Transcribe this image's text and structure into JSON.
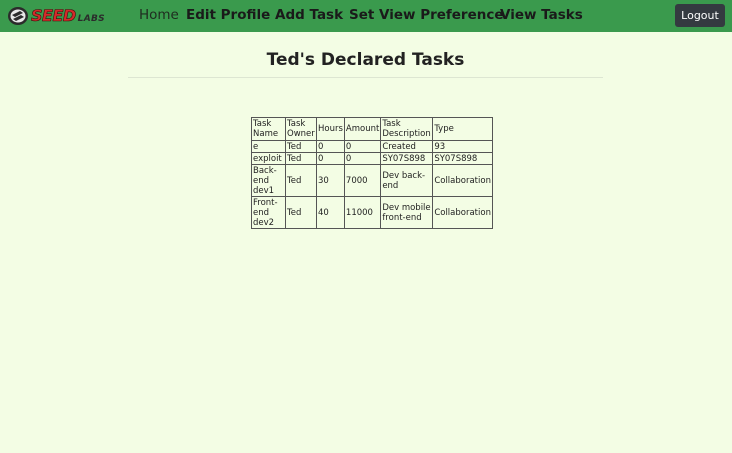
{
  "navbar": {
    "logo": {
      "text_seed": "SEED",
      "text_labs": "LABS"
    },
    "links": {
      "home": "Home",
      "edit_profile": "Edit Profile",
      "add_task": "Add Task",
      "set_view_preference": "Set View Preference",
      "view_tasks": "View Tasks"
    },
    "logout_label": "Logout",
    "colors": {
      "bar": "#3a9a4d",
      "logout_bg": "#343a40"
    }
  },
  "page": {
    "title": "Ted's Declared Tasks",
    "background": "#f3fde4"
  },
  "table": {
    "headers": [
      "Task Name",
      "Task Owner",
      "Hours",
      "Amount",
      "Task Description",
      "Type"
    ],
    "rows": [
      [
        "e",
        "Ted",
        "0",
        "0",
        "Created",
        "93"
      ],
      [
        "exploit",
        "Ted",
        "0",
        "0",
        "SY07S898",
        "SY07S898"
      ],
      [
        "Back-end dev1",
        "Ted",
        "30",
        "7000",
        "Dev back-end",
        "Collaboration"
      ],
      [
        "Front-end dev2",
        "Ted",
        "40",
        "11000",
        "Dev mobile front-end",
        "Collaboration"
      ]
    ]
  }
}
